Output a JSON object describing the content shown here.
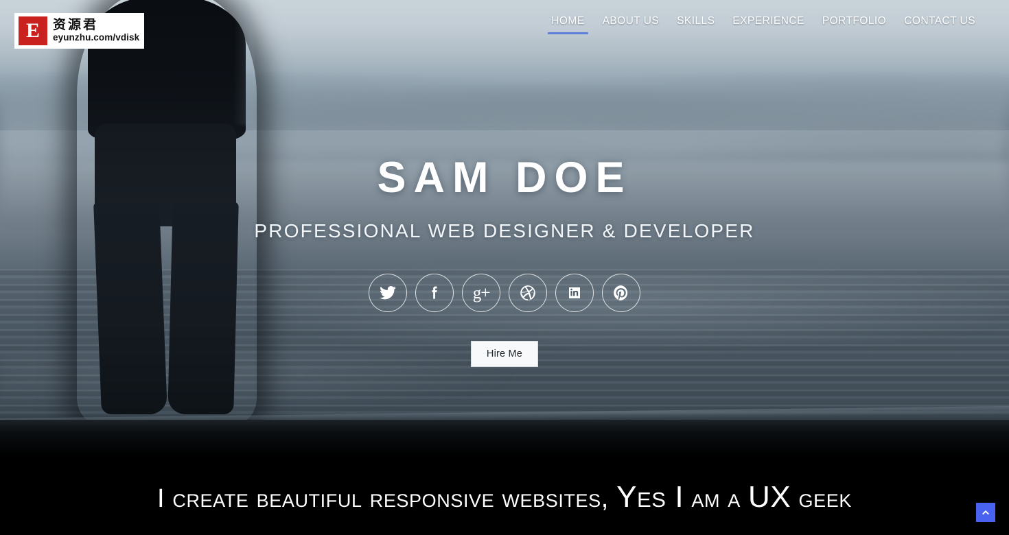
{
  "logo": {
    "mark_letter": "E",
    "cn_name": "资源君",
    "url": "eyunzhu.com/vdisk",
    "icon": "logo-mark-icon"
  },
  "nav": {
    "items": [
      {
        "label": "HOME",
        "active": true
      },
      {
        "label": "ABOUT US",
        "active": false
      },
      {
        "label": "SKILLS",
        "active": false
      },
      {
        "label": "EXPERIENCE",
        "active": false
      },
      {
        "label": "PORTFOLIO",
        "active": false
      },
      {
        "label": "CONTACT US",
        "active": false
      }
    ],
    "active_underline_color": "#5d80d8"
  },
  "hero": {
    "title": "SAM DOE",
    "subtitle": "PROFESSIONAL WEB DESIGNER & DEVELOPER",
    "cta_label": "Hire Me",
    "socials": [
      {
        "name": "twitter",
        "icon": "twitter-icon"
      },
      {
        "name": "facebook",
        "icon": "facebook-icon"
      },
      {
        "name": "google-plus",
        "icon": "google-plus-icon",
        "glyph": "g+"
      },
      {
        "name": "dribbble",
        "icon": "dribbble-icon"
      },
      {
        "name": "linkedin",
        "icon": "linkedin-icon"
      },
      {
        "name": "pinterest",
        "icon": "pinterest-icon"
      }
    ]
  },
  "band": {
    "part1": "I create beautiful responsive websites, ",
    "part2": "Yes I",
    "part3": " am a ",
    "part4": "UX",
    "part5": " geek"
  },
  "scroll_top": {
    "icon": "chevron-up-icon",
    "color": "#4a62f0"
  }
}
